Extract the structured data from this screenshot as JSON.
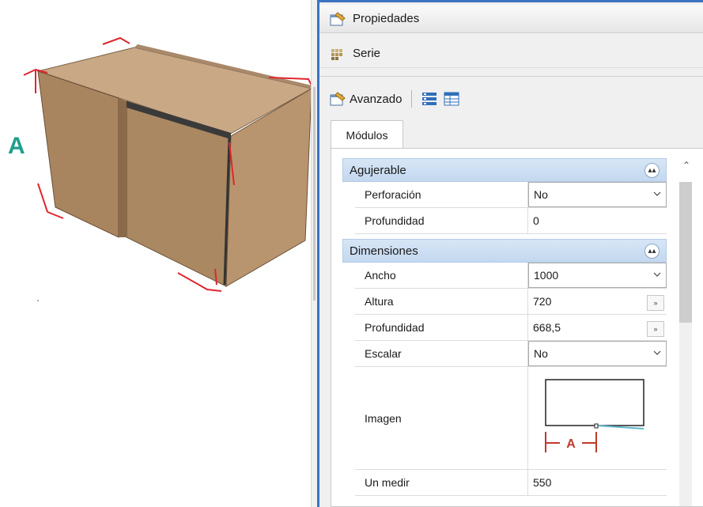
{
  "view": {
    "dimension_label": "A"
  },
  "panel": {
    "properties_title": "Propiedades",
    "series_title": "Serie",
    "toolbar": {
      "advanced_label": "Avanzado"
    },
    "tab_label": "Módulos",
    "categories": [
      {
        "name": "Agujerable",
        "rows": [
          {
            "name": "Perforación",
            "value": "No",
            "control": "dropdown"
          },
          {
            "name": "Profundidad",
            "value": "0",
            "control": "text"
          }
        ]
      },
      {
        "name": "Dimensiones",
        "rows": [
          {
            "name": "Ancho",
            "value": "1000",
            "control": "dropdown"
          },
          {
            "name": "Altura",
            "value": "720",
            "control": "ellipsis"
          },
          {
            "name": "Profundidad",
            "value": "668,5",
            "control": "ellipsis"
          },
          {
            "name": "Escalar",
            "value": "No",
            "control": "dropdown"
          },
          {
            "name": "Imagen",
            "value": "",
            "control": "image",
            "image_label": "A"
          },
          {
            "name": "Un medir",
            "value": "550",
            "control": "text"
          }
        ]
      }
    ],
    "icons": {
      "properties": "properties-icon",
      "series": "series-icon",
      "advanced": "advanced-properties-icon",
      "categorized": "categorized-view-icon",
      "table": "table-view-icon",
      "collapse": "collapse-icon",
      "dropdown": "chevron-down-icon",
      "ellipsis": "ellipsis-button"
    },
    "colors": {
      "accent_border": "#3b73c2",
      "category_band": "#c9dcf1",
      "dimension_marker": "#e0262e",
      "label_a": "#1f9e8c"
    }
  }
}
